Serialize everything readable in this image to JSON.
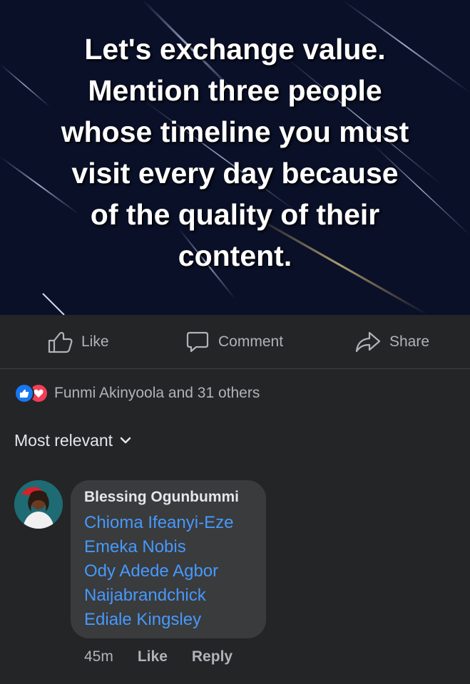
{
  "post": {
    "lines": [
      "Let's exchange value.",
      "Mention three people",
      "whose timeline you must",
      "visit every day because",
      "of the quality of their",
      "content."
    ]
  },
  "actions": {
    "like": "Like",
    "comment": "Comment",
    "share": "Share"
  },
  "reactions": {
    "summary": "Funmi Akinyoola and 31 others",
    "icons": [
      "like-icon",
      "love-icon"
    ],
    "colors": {
      "like": "#1877f2",
      "love": "#f33e58"
    }
  },
  "sort": {
    "label": "Most relevant"
  },
  "comment": {
    "author": "Blessing Ogunbummi",
    "mentions": [
      "Chioma Ifeanyi-Eze",
      "Emeka Nobis",
      "Ody Adede Agbor",
      "Naijabrandchick",
      "Ediale Kingsley"
    ],
    "time": "45m",
    "like_label": "Like",
    "reply_label": "Reply"
  },
  "colors": {
    "background": "#242526",
    "bubble": "#3a3b3c",
    "mention": "#4599ff",
    "post_background": "#0a1028"
  }
}
